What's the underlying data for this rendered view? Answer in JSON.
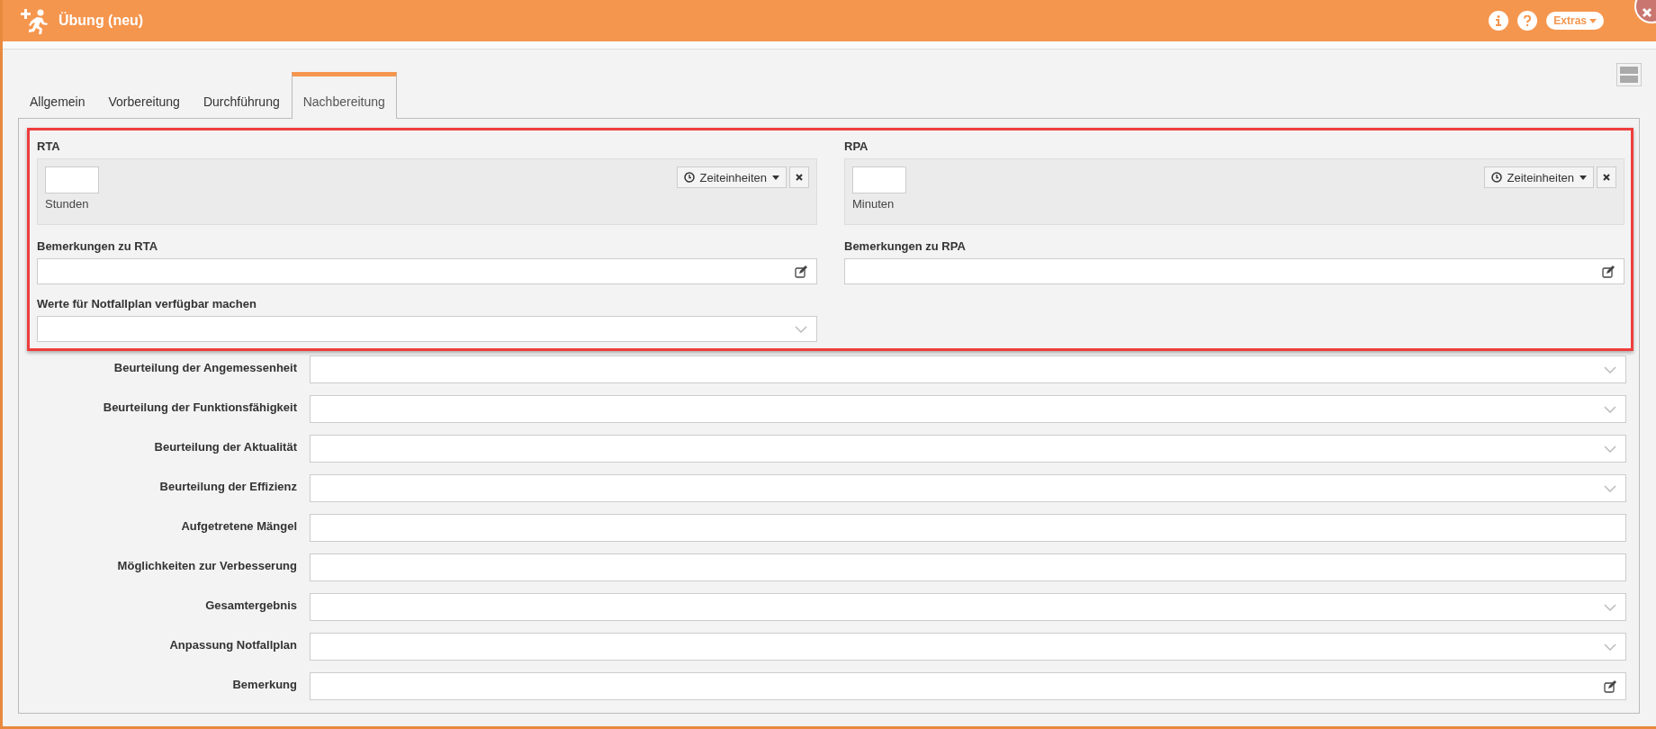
{
  "window": {
    "title": "Übung (neu)",
    "extras_button": "Extras"
  },
  "tabs": [
    {
      "label": "Allgemein",
      "selected": false
    },
    {
      "label": "Vorbereitung",
      "selected": false
    },
    {
      "label": "Durchführung",
      "selected": false
    },
    {
      "label": "Nachbereitung",
      "selected": true
    }
  ],
  "time_sections": [
    {
      "title": "RTA",
      "unit": "Stunden",
      "units_button": "Zeiteinheiten",
      "remarks_label": "Bemerkungen zu RTA"
    },
    {
      "title": "RPA",
      "unit": "Minuten",
      "units_button": "Zeiteinheiten",
      "remarks_label": "Bemerkungen zu RPA"
    }
  ],
  "availability": {
    "label": "Werte für Notfallplan verfügbar machen"
  },
  "form_rows": [
    {
      "label": "Beurteilung der Angemessenheit",
      "kind": "select"
    },
    {
      "label": "Beurteilung der Funktionsfähigkeit",
      "kind": "select"
    },
    {
      "label": "Beurteilung der Aktualität",
      "kind": "select"
    },
    {
      "label": "Beurteilung der Effizienz",
      "kind": "select"
    },
    {
      "label": "Aufgetretene Mängel",
      "kind": "text"
    },
    {
      "label": "Möglichkeiten zur Verbesserung",
      "kind": "text"
    },
    {
      "label": "Gesamtergebnis",
      "kind": "select"
    },
    {
      "label": "Anpassung Notfallplan",
      "kind": "select"
    },
    {
      "label": "Bemerkung",
      "kind": "edit"
    }
  ]
}
